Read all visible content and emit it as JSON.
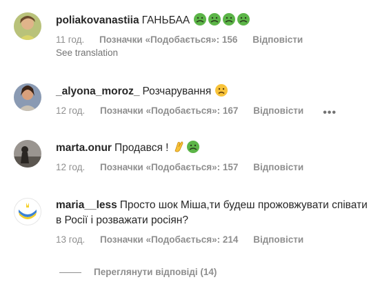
{
  "comments": [
    {
      "username": "poliakovanastiia",
      "text": "ГАНЬБАА",
      "emojis": [
        "nauseated-face",
        "nauseated-face",
        "nauseated-face",
        "nauseated-face"
      ],
      "time": "11 год.",
      "likes_label": "Позначки «Подобається»: 156",
      "reply_label": "Відповісти",
      "translation_label": "See translation"
    },
    {
      "username": "_alyona_moroz_",
      "text": "Розчарування",
      "emojis": [
        "sad-face"
      ],
      "time": "12 год.",
      "likes_label": "Позначки «Подобається»: 167",
      "reply_label": "Відповісти",
      "more_label": "•••"
    },
    {
      "username": "marta.onur",
      "text": "Продався !",
      "emojis": [
        "clapping-hands",
        "nauseated-face"
      ],
      "time": "12 год.",
      "likes_label": "Позначки «Подобається»: 157",
      "reply_label": "Відповісти"
    },
    {
      "username": "maria__less",
      "text": "Просто шок Міша,ти будеш прожовжувати співати в Росії і розважати росіян?",
      "time": "13 год.",
      "likes_label": "Позначки «Подобається»: 214",
      "reply_label": "Відповісти"
    }
  ],
  "view_replies_label": "Переглянути відповіді (14)",
  "colors": {
    "text": "#262626",
    "meta": "#8e8e8e",
    "emoji_green": "#5cb548",
    "emoji_yellow": "#f8c33a"
  }
}
